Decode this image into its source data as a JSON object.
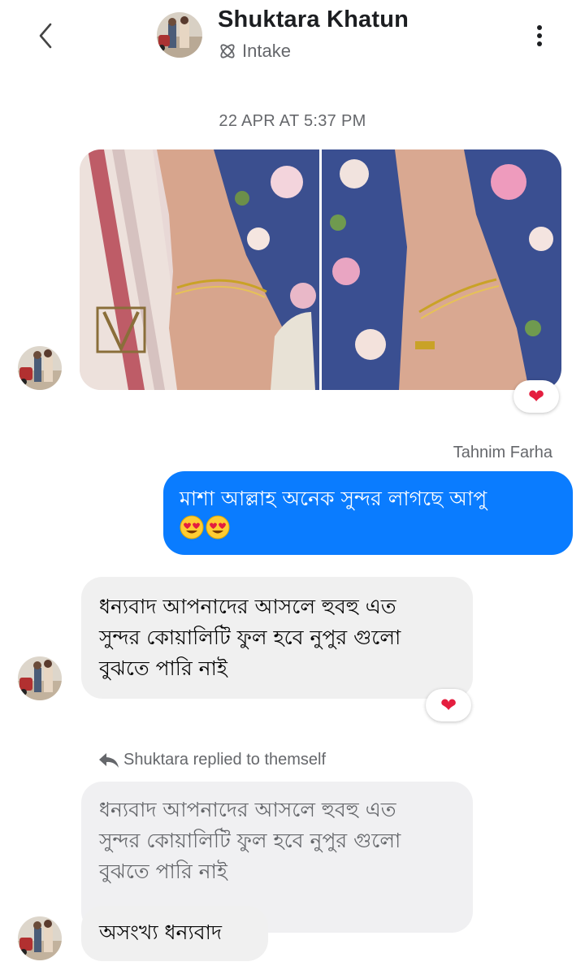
{
  "header": {
    "contact_name": "Shuktara Khatun",
    "subtitle": "Intake",
    "back_icon": "chevron-left-icon",
    "more_icon": "more-vertical-icon"
  },
  "timestamp": "22 APR AT 5:37 PM",
  "messages": {
    "image_message": {
      "images": [
        "foot-photo-left",
        "foot-photo-right"
      ],
      "reaction": "❤"
    },
    "outgoing": {
      "sender": "Tahnim Farha",
      "text": "মাশা আল্লাহ অনেক সুন্দর লাগছে আপু",
      "emojis": "😍😍"
    },
    "incoming_1": {
      "lines": [
        "ধন্যবাদ আপনাদের আসলে হুবহু এত",
        "সুন্দর কোয়ালিটি ফুল হবে নুপুর গুলো",
        "বুঝতে পারি নাই"
      ],
      "reaction": "❤"
    },
    "reply_note": "Shuktara replied to themself",
    "incoming_2": {
      "quoted_lines": [
        "ধন্যবাদ আপনাদের আসলে হুবহু এত",
        "সুন্দর কোয়ালিটি ফুল হবে নুপুর গুলো",
        "বুঝতে পারি নাই"
      ],
      "reply_text": "অসংখ্য ধন্যবাদ"
    }
  },
  "colors": {
    "outgoing_bubble": "#0a7cff",
    "incoming_bubble": "#f0f0f0",
    "reaction_heart": "#e41e3f",
    "secondary_text": "#65676b"
  }
}
